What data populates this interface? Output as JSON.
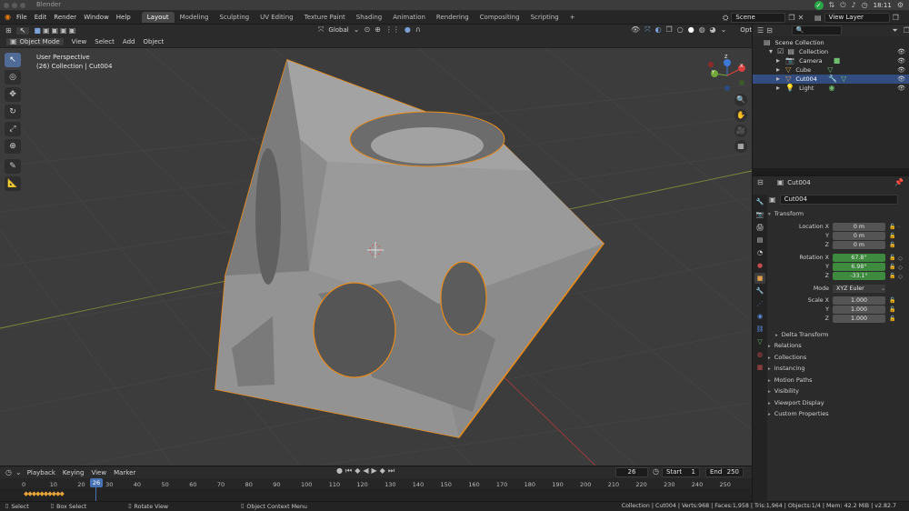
{
  "os": {
    "app_title": "Blender",
    "time": "18:11"
  },
  "menu": [
    "File",
    "Edit",
    "Render",
    "Window",
    "Help"
  ],
  "workspaces": [
    "Layout",
    "Modeling",
    "Sculpting",
    "UV Editing",
    "Texture Paint",
    "Shading",
    "Animation",
    "Rendering",
    "Compositing",
    "Scripting"
  ],
  "active_workspace": "Layout",
  "scene": {
    "name": "Scene",
    "view_layer": "View Layer"
  },
  "viewport_header": {
    "mode": "Object Mode",
    "menus": [
      "View",
      "Select",
      "Add",
      "Object"
    ],
    "orientation": "Global",
    "options": "Options"
  },
  "viewport": {
    "perspective": "User Perspective",
    "collection_info": "(26) Collection | Cut004",
    "axis_labels": {
      "x": "X",
      "y": "Y",
      "z": "Z"
    }
  },
  "outliner": {
    "search_placeholder": "",
    "rows": [
      {
        "label": "Scene Collection",
        "indent": 0,
        "selected": false
      },
      {
        "label": "Collection",
        "indent": 1,
        "selected": false
      },
      {
        "label": "Camera",
        "indent": 2,
        "selected": false,
        "icon_color": "#e0a050"
      },
      {
        "label": "Cube",
        "indent": 2,
        "selected": false,
        "icon_color": "#e0a050"
      },
      {
        "label": "Cut004",
        "indent": 2,
        "selected": true,
        "icon_color": "#e0a050"
      },
      {
        "label": "Light",
        "indent": 2,
        "selected": false,
        "icon_color": "#e0a050"
      }
    ]
  },
  "properties": {
    "object_name": "Cut004",
    "data_name": "Cut004",
    "transform_label": "Transform",
    "location": {
      "label": "Location X",
      "values": [
        "0 m",
        "0 m",
        "0 m"
      ]
    },
    "rotation": {
      "label": "Rotation X",
      "values": [
        "67.8°",
        "6.98°",
        "-33.1°"
      ]
    },
    "mode": {
      "label": "Mode",
      "value": "XYZ Euler"
    },
    "scale": {
      "label": "Scale X",
      "values": [
        "1.000",
        "1.000",
        "1.000"
      ]
    },
    "axis_y": "Y",
    "axis_z": "Z",
    "delta_transform": "Delta Transform",
    "panels": [
      "Relations",
      "Collections",
      "Instancing",
      "Motion Paths",
      "Visibility",
      "Viewport Display",
      "Custom Properties"
    ]
  },
  "timeline": {
    "menus": [
      "Playback",
      "Keying",
      "View",
      "Marker"
    ],
    "current_frame": "26",
    "start_label": "Start",
    "start": "1",
    "end_label": "End",
    "end": "250",
    "ticks": [
      "0",
      "10",
      "20",
      "30",
      "40",
      "50",
      "60",
      "70",
      "80",
      "90",
      "100",
      "110",
      "120",
      "130",
      "140",
      "150",
      "160",
      "170",
      "180",
      "190",
      "200",
      "210",
      "220",
      "230",
      "240",
      "250"
    ],
    "keyframes": "◆◆◆◆◆◆◆◆◆◆"
  },
  "statusbar": {
    "select": "Select",
    "box_select": "Box Select",
    "rotate_view": "Rotate View",
    "context_menu": "Object Context Menu",
    "stats": "Collection | Cut004 | Verts:968 | Faces:1,958 | Tris:1,964 | Objects:1/4 | Mem: 42.2 MiB | v2.82.7"
  },
  "colors": {
    "selection_outline": "#e88b1a",
    "accent_blue": "#4772b3",
    "anim_green": "#3e8a3e"
  }
}
